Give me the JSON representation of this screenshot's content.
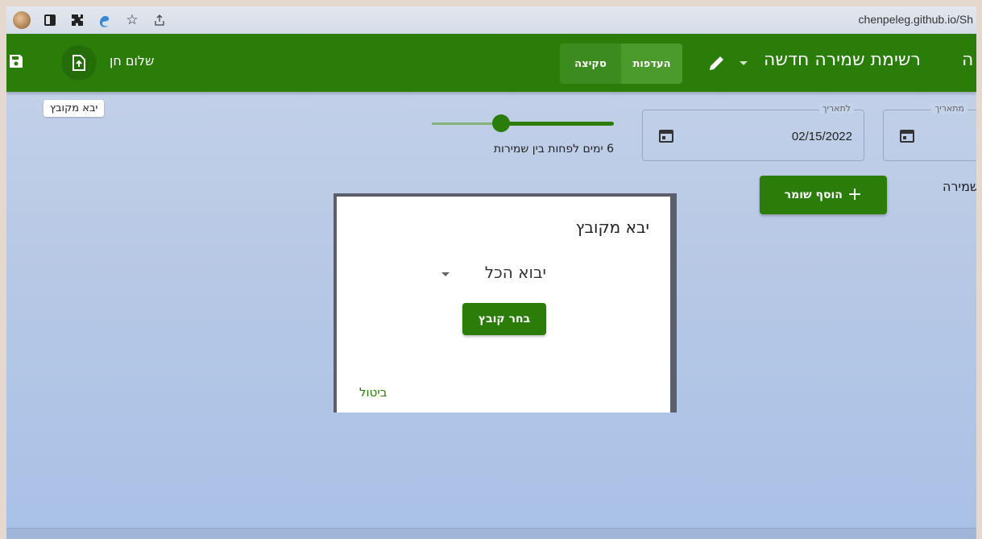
{
  "browser": {
    "url": "chenpeleg.github.io/Sh",
    "icons": [
      "avatar-icon",
      "sidebar-icon",
      "extensions-icon",
      "edge-icon",
      "star-icon",
      "share-icon"
    ]
  },
  "appbar": {
    "greeting": "שלום חן",
    "import_tooltip": "יבא מקובץ",
    "toggle": {
      "preferences_label": "העדפות",
      "draft_label": "סקיצה"
    },
    "list_title": "רשימת שמירה חדשה",
    "title_end": "ה",
    "colors": {
      "primary": "#2b7d0a"
    }
  },
  "filters": {
    "slider": {
      "value": 6,
      "label": "6 ימים לפחות בין שמירות"
    },
    "to_date": {
      "legend": "לתאריך",
      "value": "02/15/2022"
    },
    "from_date": {
      "legend": "מתאריך",
      "value": ""
    }
  },
  "main": {
    "add_guard_label": "הוסף שומר",
    "shift_label": "שמירה"
  },
  "dialog": {
    "title": "יבא מקובץ",
    "select_value": "יבוא הכל",
    "choose_file_label": "בחר קובץ",
    "cancel_label": "ביטול"
  }
}
